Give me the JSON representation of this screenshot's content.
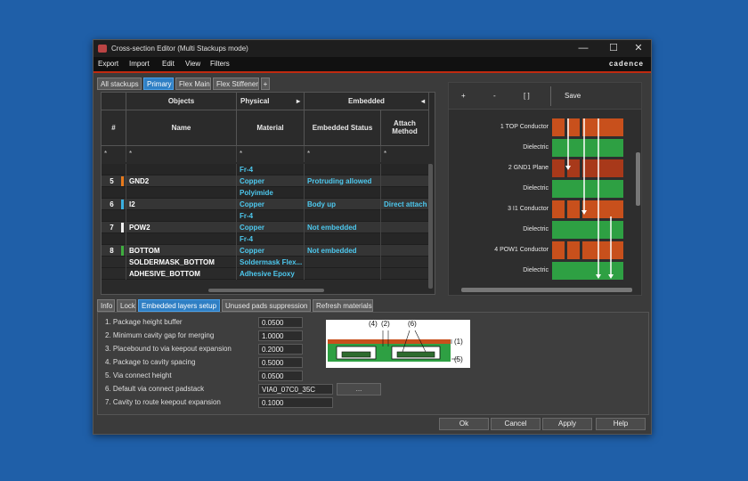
{
  "window": {
    "title": "Cross-section Editor (Multi Stackups mode)",
    "minimize": "—",
    "maximize": "☐",
    "close": "✕"
  },
  "menu": {
    "items": [
      "Export",
      "Import",
      "Edit",
      "View",
      "Filters"
    ],
    "brand": "cadence"
  },
  "top_tabs": [
    "All stackups",
    "Primary",
    "Flex Main",
    "Flex Stiffener",
    "+"
  ],
  "top_tabs_active": "Primary",
  "grid": {
    "group_headers": {
      "objects": "Objects",
      "physical": "Physical",
      "physical_arrow": "▸",
      "embedded": "Embedded",
      "embedded_arrow": "◂"
    },
    "columns": {
      "num": "#",
      "name": "Name",
      "material": "Material",
      "embedded_status": "Embedded Status",
      "attach_method_1": "Attach",
      "attach_method_2": "Method"
    },
    "filter": [
      "*",
      "*",
      "*",
      "*",
      "*"
    ],
    "rows": [
      {
        "num": "",
        "name": "",
        "material": "Fr-4",
        "status": "",
        "attach": "",
        "swatch": "",
        "kind": "dielectric"
      },
      {
        "num": "5",
        "name": "GND2",
        "material": "Copper",
        "status": "Protruding allowed",
        "attach": "",
        "swatch": "#e87a1c",
        "kind": "conductor"
      },
      {
        "num": "",
        "name": "",
        "material": "Polyimide",
        "status": "",
        "attach": "",
        "swatch": "",
        "kind": "dielectric"
      },
      {
        "num": "6",
        "name": "I2",
        "material": "Copper",
        "status": "Body up",
        "attach": "Direct attach",
        "swatch": "#3ab0e0",
        "kind": "conductor"
      },
      {
        "num": "",
        "name": "",
        "material": "Fr-4",
        "status": "",
        "attach": "",
        "swatch": "",
        "kind": "dielectric"
      },
      {
        "num": "7",
        "name": "POW2",
        "material": "Copper",
        "status": "Not embedded",
        "attach": "",
        "swatch": "#f0f0f0",
        "kind": "conductor"
      },
      {
        "num": "",
        "name": "",
        "material": "Fr-4",
        "status": "",
        "attach": "",
        "swatch": "",
        "kind": "dielectric"
      },
      {
        "num": "8",
        "name": "BOTTOM",
        "material": "Copper",
        "status": "Not embedded",
        "attach": "",
        "swatch": "#3fae3f",
        "kind": "conductor"
      },
      {
        "num": "",
        "name": "SOLDERMASK_BOTTOM",
        "material": "Soldermask Flex...",
        "status": "",
        "attach": "",
        "swatch": "",
        "kind": "mask"
      },
      {
        "num": "",
        "name": "ADHESIVE_BOTTOM",
        "material": "Adhesive Epoxy",
        "status": "",
        "attach": "",
        "swatch": "",
        "kind": "mask"
      }
    ]
  },
  "right_toolbar": [
    "+",
    "-",
    "[ ]",
    "Save"
  ],
  "cross_section": {
    "layers": [
      {
        "label": "1   TOP Conductor",
        "type": "conductor"
      },
      {
        "label": "Dielectric",
        "type": "dielectric"
      },
      {
        "label": "2   GND1 Plane",
        "type": "plane"
      },
      {
        "label": "Dielectric",
        "type": "dielectric"
      },
      {
        "label": "3   I1 Conductor",
        "type": "conductor"
      },
      {
        "label": "Dielectric",
        "type": "dielectric"
      },
      {
        "label": "4   POW1 Conductor",
        "type": "conductor"
      },
      {
        "label": "Dielectric",
        "type": "dielectric"
      }
    ],
    "colors": {
      "conductor": "#c8501c",
      "plane": "#a8391a",
      "dielectric": "#2ea043"
    }
  },
  "bottom_tabs": [
    "Info",
    "Lock",
    "Embedded layers setup",
    "Unused pads suppression",
    "Refresh materials"
  ],
  "bottom_tabs_active": "Embedded layers setup",
  "params": [
    {
      "label": "1. Package height buffer",
      "value": "0.0500"
    },
    {
      "label": "2. Minimum cavity gap for merging",
      "value": "1.0000"
    },
    {
      "label": "3. Placebound to via keepout expansion",
      "value": "0.2000"
    },
    {
      "label": "4. Package to cavity spacing",
      "value": "0.5000"
    },
    {
      "label": "5. Via connect height",
      "value": "0.0500"
    },
    {
      "label": "6. Default via connect padstack",
      "value": "VIA0_07C0_35C"
    },
    {
      "label": "7. Cavity to route keepout expansion",
      "value": "0.1000"
    }
  ],
  "browse_button": "...",
  "diagram_labels": {
    "l4": "(4)",
    "l2": "(2)",
    "l6": "(6)",
    "l1": "(1)",
    "l5": "(5)"
  },
  "footer": {
    "ok": "Ok",
    "cancel": "Cancel",
    "apply": "Apply",
    "help": "Help"
  }
}
